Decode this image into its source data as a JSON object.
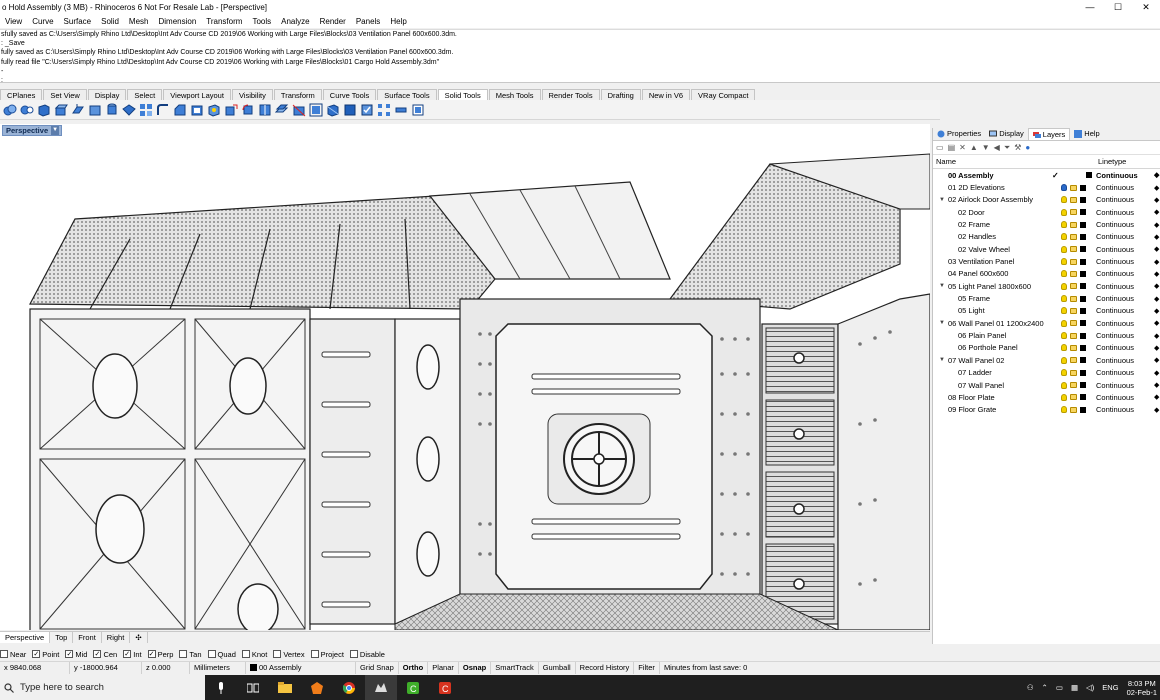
{
  "window": {
    "title": "o Hold Assembly (3 MB) - Rhinoceros 6 Not For Resale Lab - [Perspective]",
    "minimize_glyph": "—",
    "maximize_glyph": "☐",
    "close_glyph": "✕"
  },
  "menu": [
    "View",
    "Curve",
    "Surface",
    "Solid",
    "Mesh",
    "Dimension",
    "Transform",
    "Tools",
    "Analyze",
    "Render",
    "Panels",
    "Help"
  ],
  "command_history": [
    "sfully saved as C:\\Users\\Simply Rhino Ltd\\Desktop\\Int Adv Course CD 2019\\06 Working with Large Files\\Blocks\\03 Ventilation Panel 600x600.3dm.",
    ": _Save",
    "fully saved as C:\\Users\\Simply Rhino Ltd\\Desktop\\Int Adv Course CD 2019\\06 Working with Large Files\\Blocks\\03 Ventilation Panel 600x600.3dm.",
    "fully read file \"C:\\Users\\Simply Rhino Ltd\\Desktop\\Int Adv Course CD 2019\\06 Working with Large Files\\Blocks\\01 Cargo Hold Assembly.3dm\"",
    "-",
    ":"
  ],
  "toolbar_tabs": [
    "CPlanes",
    "Set View",
    "Display",
    "Select",
    "Viewport Layout",
    "Visibility",
    "Transform",
    "Curve Tools",
    "Surface Tools",
    "Solid Tools",
    "Mesh Tools",
    "Render Tools",
    "Drafting",
    "New in V6",
    "VRay Compact"
  ],
  "active_toolbar_tab": "Solid Tools",
  "viewport": {
    "name": "Perspective",
    "tabs": [
      "Perspective",
      "Top",
      "Front",
      "Right"
    ],
    "add_tab_glyph": "✣"
  },
  "panel": {
    "tabs": [
      {
        "label": "Properties",
        "icon": "properties-icon"
      },
      {
        "label": "Display",
        "icon": "display-icon"
      },
      {
        "label": "Layers",
        "icon": "layers-icon"
      },
      {
        "label": "Help",
        "icon": "help-icon"
      }
    ],
    "active_tab": "Layers",
    "columns": {
      "name": "Name",
      "linetype": "Linetype"
    },
    "layers": [
      {
        "name": "00 Assembly",
        "indent": 0,
        "expand": "",
        "current": true,
        "linetype": "Continuous"
      },
      {
        "name": "01 2D Elevations",
        "indent": 0,
        "expand": "",
        "current": false,
        "linetype": "Continuous"
      },
      {
        "name": "02 Airlock Door Assembly",
        "indent": 0,
        "expand": "v",
        "current": false,
        "linetype": "Continuous"
      },
      {
        "name": "02 Door",
        "indent": 1,
        "expand": "",
        "current": false,
        "linetype": "Continuous"
      },
      {
        "name": "02 Frame",
        "indent": 1,
        "expand": "",
        "current": false,
        "linetype": "Continuous"
      },
      {
        "name": "02 Handles",
        "indent": 1,
        "expand": "",
        "current": false,
        "linetype": "Continuous"
      },
      {
        "name": "02 Valve Wheel",
        "indent": 1,
        "expand": "",
        "current": false,
        "linetype": "Continuous"
      },
      {
        "name": "03 Ventilation Panel",
        "indent": 0,
        "expand": "",
        "current": false,
        "linetype": "Continuous"
      },
      {
        "name": "04 Panel 600x600",
        "indent": 0,
        "expand": "",
        "current": false,
        "linetype": "Continuous"
      },
      {
        "name": "05 Light Panel 1800x600",
        "indent": 0,
        "expand": "v",
        "current": false,
        "linetype": "Continuous"
      },
      {
        "name": "05 Frame",
        "indent": 1,
        "expand": "",
        "current": false,
        "linetype": "Continuous"
      },
      {
        "name": "05 Light",
        "indent": 1,
        "expand": "",
        "current": false,
        "linetype": "Continuous"
      },
      {
        "name": "06 Wall Panel 01 1200x2400",
        "indent": 0,
        "expand": "v",
        "current": false,
        "linetype": "Continuous"
      },
      {
        "name": "06 Plain Panel",
        "indent": 1,
        "expand": "",
        "current": false,
        "linetype": "Continuous"
      },
      {
        "name": "06 Porthole Panel",
        "indent": 1,
        "expand": "",
        "current": false,
        "linetype": "Continuous"
      },
      {
        "name": "07 Wall Panel 02",
        "indent": 0,
        "expand": "v",
        "current": false,
        "linetype": "Continuous"
      },
      {
        "name": "07 Ladder",
        "indent": 1,
        "expand": "",
        "current": false,
        "linetype": "Continuous"
      },
      {
        "name": "07 Wall Panel",
        "indent": 1,
        "expand": "",
        "current": false,
        "linetype": "Continuous"
      },
      {
        "name": "08 Floor Plate",
        "indent": 0,
        "expand": "",
        "current": false,
        "linetype": "Continuous"
      },
      {
        "name": "09 Floor Grate",
        "indent": 0,
        "expand": "",
        "current": false,
        "linetype": "Continuous"
      }
    ]
  },
  "osnaps": [
    {
      "label": "Near",
      "checked": false
    },
    {
      "label": "Point",
      "checked": true
    },
    {
      "label": "Mid",
      "checked": true
    },
    {
      "label": "Cen",
      "checked": true
    },
    {
      "label": "Int",
      "checked": true
    },
    {
      "label": "Perp",
      "checked": true
    },
    {
      "label": "Tan",
      "checked": false
    },
    {
      "label": "Quad",
      "checked": false
    },
    {
      "label": "Knot",
      "checked": false
    },
    {
      "label": "Vertex",
      "checked": false
    },
    {
      "label": "Project",
      "checked": false
    },
    {
      "label": "Disable",
      "checked": false
    }
  ],
  "status": {
    "x": "x 9840.068",
    "y": "y -18000.964",
    "z": "z 0.000",
    "units": "Millimeters",
    "layer": "00 Assembly",
    "toggles": [
      {
        "label": "Grid Snap",
        "bold": false
      },
      {
        "label": "Ortho",
        "bold": true
      },
      {
        "label": "Planar",
        "bold": false
      },
      {
        "label": "Osnap",
        "bold": true
      },
      {
        "label": "SmartTrack",
        "bold": false
      },
      {
        "label": "Gumball",
        "bold": false
      },
      {
        "label": "Record History",
        "bold": false
      },
      {
        "label": "Filter",
        "bold": false
      }
    ],
    "save_info": "Minutes from last save: 0"
  },
  "taskbar": {
    "search_placeholder": "Type here to search",
    "language": "ENG",
    "time": "8:03 PM",
    "date": "02-Feb-1"
  }
}
